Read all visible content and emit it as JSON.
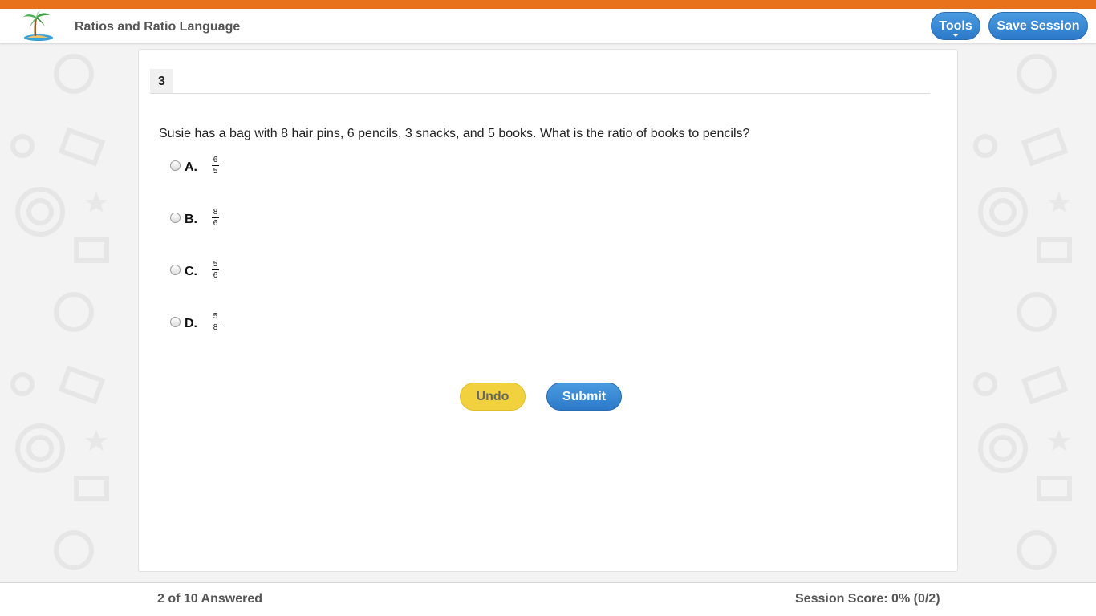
{
  "header": {
    "title": "Ratios and Ratio Language",
    "tools_label": "Tools",
    "save_label": "Save Session",
    "logo_icon": "palm-tree-island-icon"
  },
  "colors": {
    "accent_orange": "#e8711c",
    "button_blue": "#3a8ad6",
    "undo_yellow": "#f1d23e"
  },
  "question": {
    "number": "3",
    "text": "Susie has a bag with 8 hair pins, 6 pencils, 3 snacks, and 5 books. What is the ratio of books to pencils?",
    "options": [
      {
        "letter": "A.",
        "numerator": "6",
        "denominator": "5"
      },
      {
        "letter": "B.",
        "numerator": "8",
        "denominator": "6"
      },
      {
        "letter": "C.",
        "numerator": "5",
        "denominator": "6"
      },
      {
        "letter": "D.",
        "numerator": "5",
        "denominator": "8"
      }
    ]
  },
  "actions": {
    "undo_label": "Undo",
    "submit_label": "Submit"
  },
  "footer": {
    "answered": "2 of 10 Answered",
    "score": "Session Score: 0% (0/2)"
  }
}
